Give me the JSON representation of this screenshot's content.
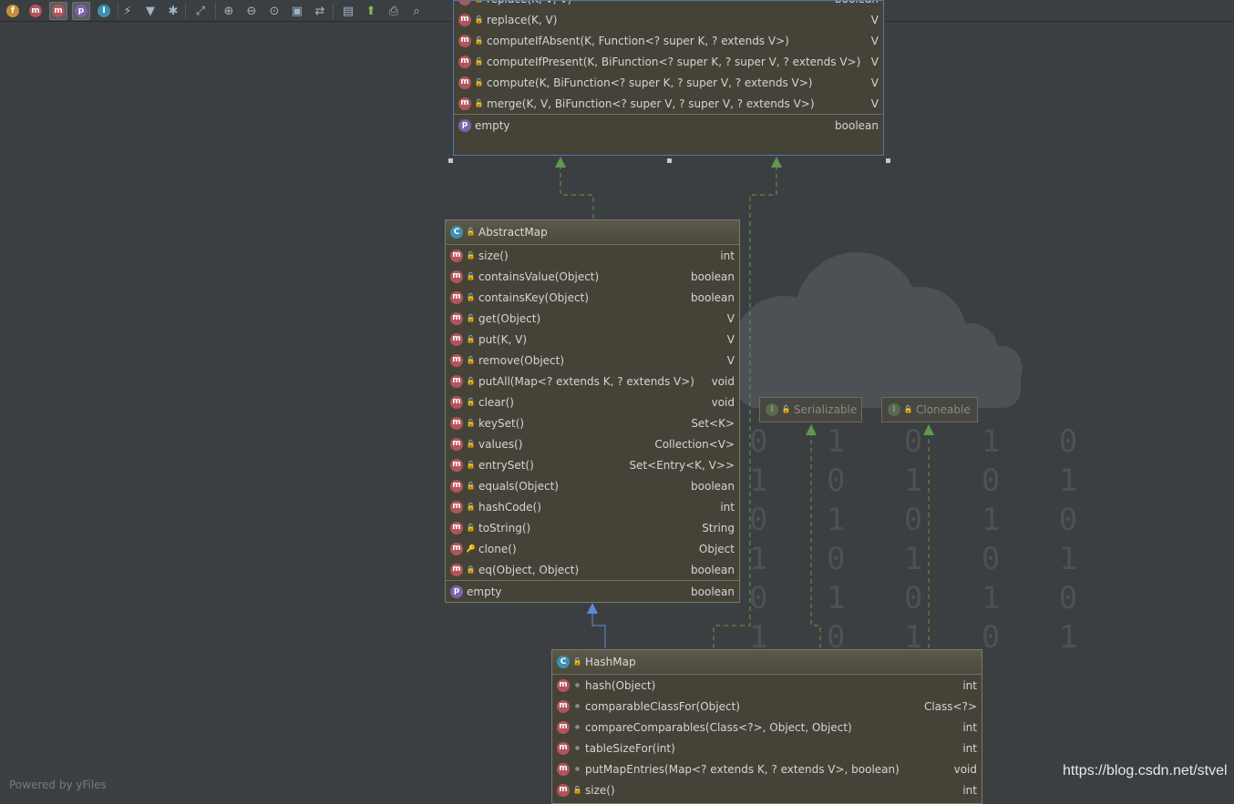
{
  "toolbar": {
    "filter_buttons": [
      {
        "label": "f",
        "color": "#c28f3a",
        "icon": "fields-filter-icon"
      },
      {
        "label": "m",
        "color": "#b0555b",
        "icon": "constructors-filter-icon"
      },
      {
        "label": "m",
        "color": "#b0555b",
        "icon": "methods-filter-icon"
      },
      {
        "label": "p",
        "color": "#7d62a6",
        "icon": "properties-filter-icon"
      },
      {
        "label": "I",
        "color": "#3f8fb1",
        "icon": "inner-classes-filter-icon"
      }
    ]
  },
  "top_node": {
    "methods": [
      {
        "sig": "replace(K, V, V)",
        "ret": "boolean"
      },
      {
        "sig": "replace(K, V)",
        "ret": "V"
      },
      {
        "sig": "computeIfAbsent(K, Function<? super K, ? extends V>)",
        "ret": "V"
      },
      {
        "sig": "computeIfPresent(K, BiFunction<? super K, ? super V, ? extends V>)",
        "ret": "V"
      },
      {
        "sig": "compute(K, BiFunction<? super K, ? super V, ? extends V>)",
        "ret": "V"
      },
      {
        "sig": "merge(K, V, BiFunction<? super V, ? super V, ? extends V>)",
        "ret": "V"
      }
    ],
    "properties": [
      {
        "name": "empty",
        "type": "boolean"
      }
    ]
  },
  "abstract_map": {
    "title": "AbstractMap",
    "methods": [
      {
        "sig": "size()",
        "ret": "int",
        "vis": "pub"
      },
      {
        "sig": "containsValue(Object)",
        "ret": "boolean",
        "vis": "pub"
      },
      {
        "sig": "containsKey(Object)",
        "ret": "boolean",
        "vis": "pub"
      },
      {
        "sig": "get(Object)",
        "ret": "V",
        "vis": "pub"
      },
      {
        "sig": "put(K, V)",
        "ret": "V",
        "vis": "pub"
      },
      {
        "sig": "remove(Object)",
        "ret": "V",
        "vis": "pub"
      },
      {
        "sig": "putAll(Map<? extends K, ? extends V>)",
        "ret": "void",
        "vis": "pub"
      },
      {
        "sig": "clear()",
        "ret": "void",
        "vis": "pub"
      },
      {
        "sig": "keySet()",
        "ret": "Set<K>",
        "vis": "pub"
      },
      {
        "sig": "values()",
        "ret": "Collection<V>",
        "vis": "pub"
      },
      {
        "sig": "entrySet()",
        "ret": "Set<Entry<K, V>>",
        "vis": "pub"
      },
      {
        "sig": "equals(Object)",
        "ret": "boolean",
        "vis": "pub"
      },
      {
        "sig": "hashCode()",
        "ret": "int",
        "vis": "pub"
      },
      {
        "sig": "toString()",
        "ret": "String",
        "vis": "pub"
      },
      {
        "sig": "clone()",
        "ret": "Object",
        "vis": "prot"
      },
      {
        "sig": "eq(Object, Object)",
        "ret": "boolean",
        "vis": "priv"
      }
    ],
    "properties": [
      {
        "name": "empty",
        "type": "boolean"
      }
    ]
  },
  "hash_map": {
    "title": "HashMap",
    "methods": [
      {
        "sig": "hash(Object)",
        "ret": "int",
        "vis": "pkg"
      },
      {
        "sig": "comparableClassFor(Object)",
        "ret": "Class<?>",
        "vis": "pkg"
      },
      {
        "sig": "compareComparables(Class<?>, Object, Object)",
        "ret": "int",
        "vis": "pkg"
      },
      {
        "sig": "tableSizeFor(int)",
        "ret": "int",
        "vis": "pkg"
      },
      {
        "sig": "putMapEntries(Map<? extends K, ? extends V>, boolean)",
        "ret": "void",
        "vis": "pkg"
      },
      {
        "sig": "size()",
        "ret": "int",
        "vis": "pub"
      }
    ]
  },
  "serializable": {
    "title": "Serializable"
  },
  "cloneable": {
    "title": "Cloneable"
  },
  "footer": {
    "powered_by": "Powered by yFiles",
    "watermark": "https://blog.csdn.net/stvel"
  }
}
